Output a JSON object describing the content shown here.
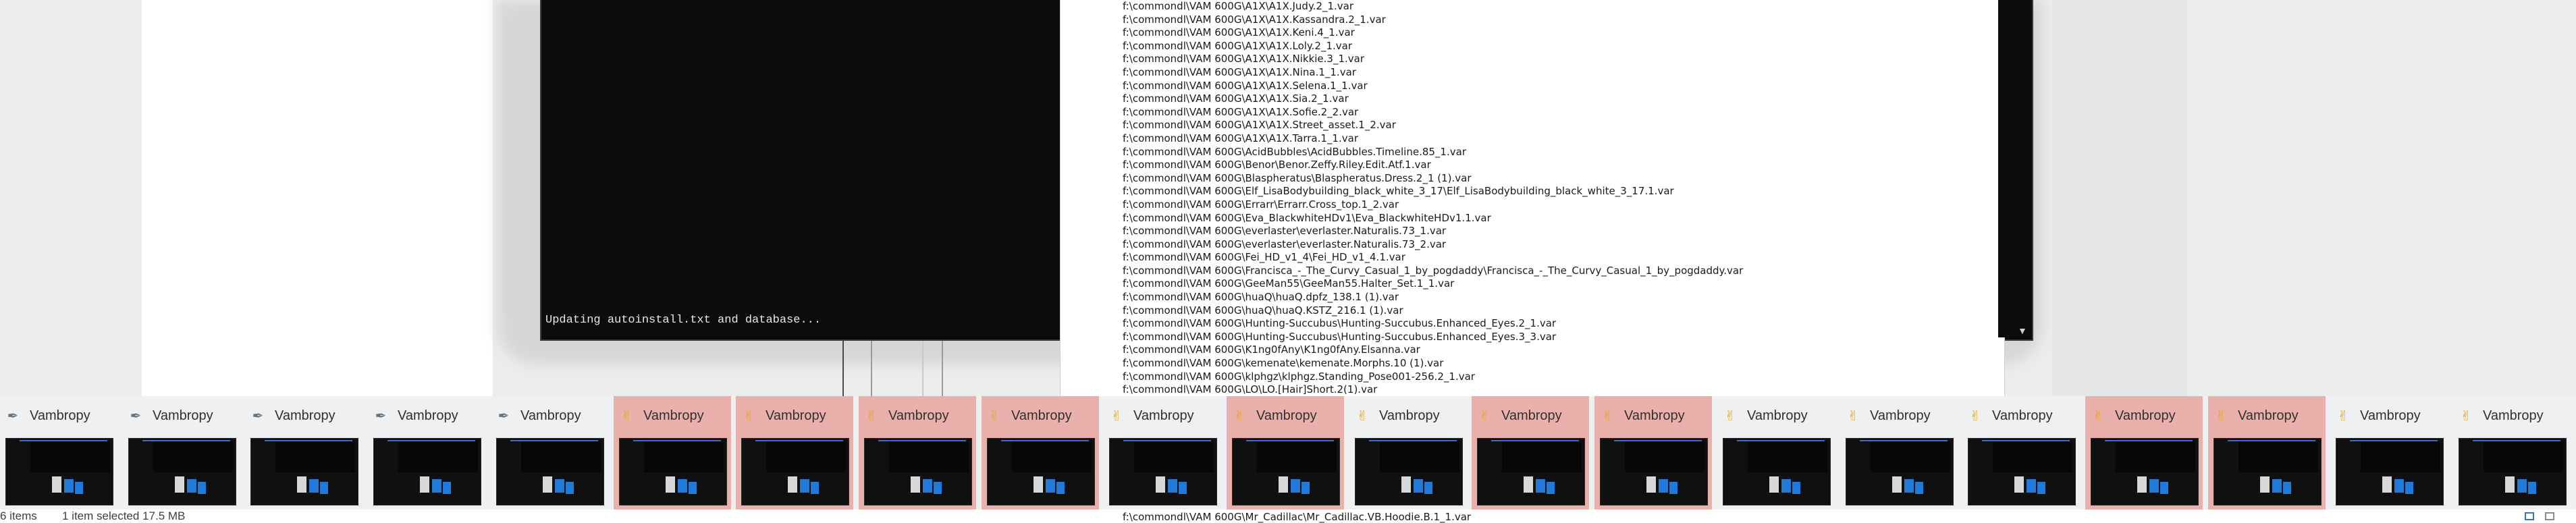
{
  "console": {
    "status_text": "Updating autoinstall.txt and database...",
    "scroll_arrow": "▼"
  },
  "document": {
    "lines": [
      "f:\\commondl\\VAM 600G\\A1X\\A1X.Judy.2_1.var",
      "f:\\commondl\\VAM 600G\\A1X\\A1X.Kassandra.2_1.var",
      "f:\\commondl\\VAM 600G\\A1X\\A1X.Keni.4_1.var",
      "f:\\commondl\\VAM 600G\\A1X\\A1X.Loly.2_1.var",
      "f:\\commondl\\VAM 600G\\A1X\\A1X.Nikkie.3_1.var",
      "f:\\commondl\\VAM 600G\\A1X\\A1X.Nina.1_1.var",
      "f:\\commondl\\VAM 600G\\A1X\\A1X.Selena.1_1.var",
      "f:\\commondl\\VAM 600G\\A1X\\A1X.Sia.2_1.var",
      "f:\\commondl\\VAM 600G\\A1X\\A1X.Sofie.2_2.var",
      "f:\\commondl\\VAM 600G\\A1X\\A1X.Street_asset.1_2.var",
      "f:\\commondl\\VAM 600G\\A1X\\A1X.Tarra.1_1.var",
      "f:\\commondl\\VAM 600G\\AcidBubbles\\AcidBubbles.Timeline.85_1.var",
      "f:\\commondl\\VAM 600G\\Benor\\Benor.Zeffy.Riley.Edit.Atf.1.var",
      "f:\\commondl\\VAM 600G\\Blaspheratus\\Blaspheratus.Dress.2_1 (1).var",
      "f:\\commondl\\VAM 600G\\Elf_LisaBodybuilding_black_white_3_17\\Elf_LisaBodybuilding_black_white_3_17.1.var",
      "f:\\commondl\\VAM 600G\\Errarr\\Errarr.Cross_top.1_2.var",
      "f:\\commondl\\VAM 600G\\Eva_BlackwhiteHDv1\\Eva_BlackwhiteHDv1.1.var",
      "f:\\commondl\\VAM 600G\\everlaster\\everlaster.Naturalis.73_1.var",
      "f:\\commondl\\VAM 600G\\everlaster\\everlaster.Naturalis.73_2.var",
      "f:\\commondl\\VAM 600G\\Fei_HD_v1_4\\Fei_HD_v1_4.1.var",
      "f:\\commondl\\VAM 600G\\Francisca_-_The_Curvy_Casual_1_by_pogdaddy\\Francisca_-_The_Curvy_Casual_1_by_pogdaddy.var",
      "f:\\commondl\\VAM 600G\\GeeMan55\\GeeMan55.Halter_Set.1_1.var",
      "f:\\commondl\\VAM 600G\\huaQ\\huaQ.dpfz_138.1 (1).var",
      "f:\\commondl\\VAM 600G\\huaQ\\huaQ.KSTZ_216.1 (1).var",
      "f:\\commondl\\VAM 600G\\Hunting-Succubus\\Hunting-Succubus.Enhanced_Eyes.2_1.var",
      "f:\\commondl\\VAM 600G\\Hunting-Succubus\\Hunting-Succubus.Enhanced_Eyes.3_3.var",
      "f:\\commondl\\VAM 600G\\K1ng0fAny\\K1ng0fAny.Elsanna.var",
      "f:\\commondl\\VAM 600G\\kemenate\\kemenate.Morphs.10 (1).var",
      "f:\\commondl\\VAM 600G\\klphgz\\klphgz.Standing_Pose001-256.2_1.var",
      "f:\\commondl\\VAM 600G\\LO\\LO.[Hair]Short.2(1).var"
    ],
    "bottom_line": "f:\\commondl\\VAM 600G\\Mr_Cadillac\\Mr_Cadillac.VB.Hoodie.B.1_1.var"
  },
  "taskbar_previews": [
    {
      "title": "Vambropy",
      "icon": "feather-icon",
      "active": false
    },
    {
      "title": "Vambropy",
      "icon": "feather-icon",
      "active": false
    },
    {
      "title": "Vambropy",
      "icon": "feather-icon",
      "active": false
    },
    {
      "title": "Vambropy",
      "icon": "feather-icon",
      "active": false
    },
    {
      "title": "Vambropy",
      "icon": "feather-icon",
      "active": false
    },
    {
      "title": "Vambropy",
      "icon": "peace-hand-icon",
      "active": true
    },
    {
      "title": "Vambropy",
      "icon": "peace-hand-icon",
      "active": true
    },
    {
      "title": "Vambropy",
      "icon": "peace-hand-icon",
      "active": true
    },
    {
      "title": "Vambropy",
      "icon": "peace-hand-icon",
      "active": true
    },
    {
      "title": "Vambropy",
      "icon": "peace-hand-icon",
      "active": false
    },
    {
      "title": "Vambropy",
      "icon": "peace-hand-icon",
      "active": true
    },
    {
      "title": "Vambropy",
      "icon": "peace-hand-icon",
      "active": false
    },
    {
      "title": "Vambropy",
      "icon": "peace-hand-icon",
      "active": true
    },
    {
      "title": "Vambropy",
      "icon": "peace-hand-icon",
      "active": true
    },
    {
      "title": "Vambropy",
      "icon": "peace-hand-icon",
      "active": false
    },
    {
      "title": "Vambropy",
      "icon": "peace-hand-icon",
      "active": false
    },
    {
      "title": "Vambropy",
      "icon": "peace-hand-icon",
      "active": false
    },
    {
      "title": "Vambropy",
      "icon": "peace-hand-icon",
      "active": true
    },
    {
      "title": "Vambropy",
      "icon": "peace-hand-icon",
      "active": true
    },
    {
      "title": "Vambropy",
      "icon": "peace-hand-icon",
      "active": false
    },
    {
      "title": "Vambropy",
      "icon": "peace-hand-icon",
      "active": false
    }
  ],
  "statusbar": {
    "item_count": "6 items",
    "selection": "1 item selected  17.5 MB"
  },
  "colors": {
    "active_preview": "#eab1ac",
    "console_bg": "#0c0c0c",
    "accent_blue": "#1f7ad9"
  }
}
